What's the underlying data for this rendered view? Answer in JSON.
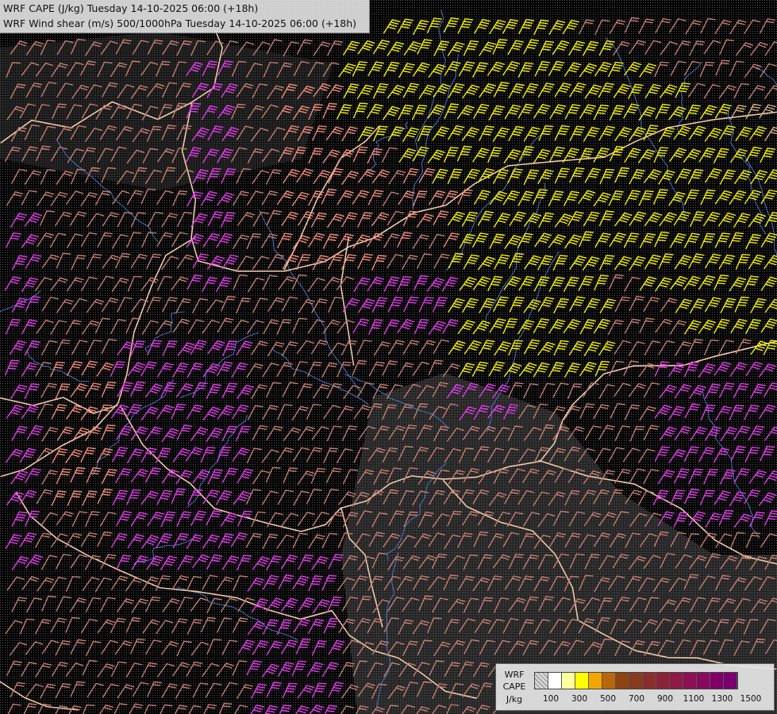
{
  "title": {
    "line1": "WRF CAPE (J/kg) Tuesday 14-10-2025 06:00 (+18h)",
    "line2": "WRF Wind shear (m/s) 500/1000hPa Tuesday 14-10-2025 06:00 (+18h)"
  },
  "legend": {
    "label_line1": "WRF",
    "label_line2": "CAPE",
    "label_line3": "J/kg",
    "ticks": [
      "100",
      "300",
      "500",
      "700",
      "900",
      "1100",
      "1300",
      "1500"
    ],
    "colors": [
      "#c8c8c8",
      "#ffffff",
      "#ffff9e",
      "#ffff00",
      "#f3a600",
      "#b8670a",
      "#8c4410",
      "#883a20",
      "#8a2d2d",
      "#8c2238",
      "#8d1b46",
      "#8c1154",
      "#880a5e",
      "#800068",
      "#78006e"
    ]
  },
  "barb_colors": {
    "low": "#c47e73",
    "mid": "#f08c7a",
    "high": "#e23ce8",
    "very_high": "#f4f000",
    "tan": "#d9b07a"
  },
  "border_color": "#f0c8a8",
  "river_color": "#4f7fd8"
}
